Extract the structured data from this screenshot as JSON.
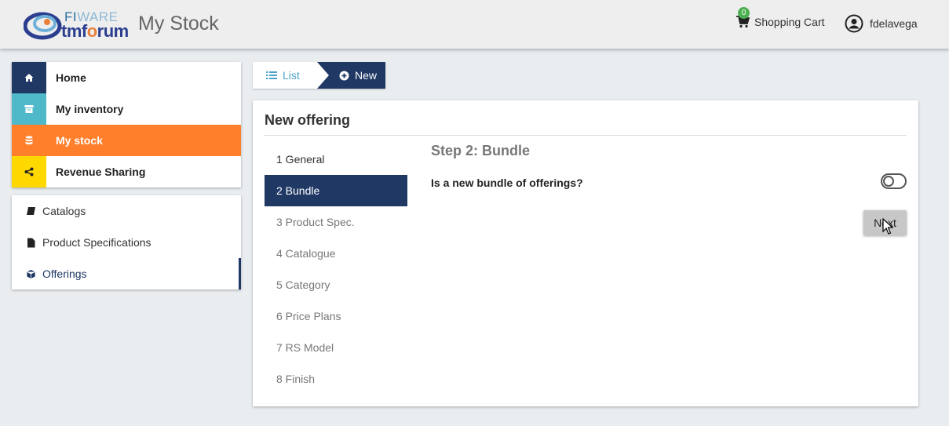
{
  "header": {
    "logo_text_top_a": "FI",
    "logo_text_top_b": "WARE",
    "logo_text_bottom_a": "tm",
    "logo_text_bottom_b": "f",
    "logo_text_bottom_c": "o",
    "logo_text_bottom_d": "rum",
    "title": "My Stock",
    "cart_label": "Shopping Cart",
    "cart_count": "0",
    "username": "fdelavega"
  },
  "sidebar": {
    "main_items": [
      {
        "label": "Home",
        "icon": "home-icon",
        "color": "#1f3864"
      },
      {
        "label": "My inventory",
        "icon": "archive-icon",
        "color": "#4fb8c9"
      },
      {
        "label": "My stock",
        "icon": "database-icon",
        "color": "#ff7f2a"
      },
      {
        "label": "Revenue Sharing",
        "icon": "share-icon",
        "color": "#ffd800"
      }
    ],
    "sub_items": [
      {
        "label": "Catalogs",
        "icon": "book-icon"
      },
      {
        "label": "Product Specifications",
        "icon": "file-icon"
      },
      {
        "label": "Offerings",
        "icon": "cube-icon"
      }
    ]
  },
  "tabs": {
    "list_label": "List",
    "new_label": "New"
  },
  "panel": {
    "title": "New offering",
    "steps": [
      "1 General",
      "2 Bundle",
      "3 Product Spec.",
      "4 Catalogue",
      "5 Category",
      "6 Price Plans",
      "7 RS Model",
      "8 Finish"
    ],
    "active_step": "2 Bundle",
    "step_heading": "Step 2: Bundle",
    "question": "Is a new bundle of offerings?",
    "toggle_on": false,
    "next_label": "Next"
  },
  "colors": {
    "primary": "#1f3864",
    "accent": "#ff7f2a",
    "link": "#4fa3c9"
  }
}
